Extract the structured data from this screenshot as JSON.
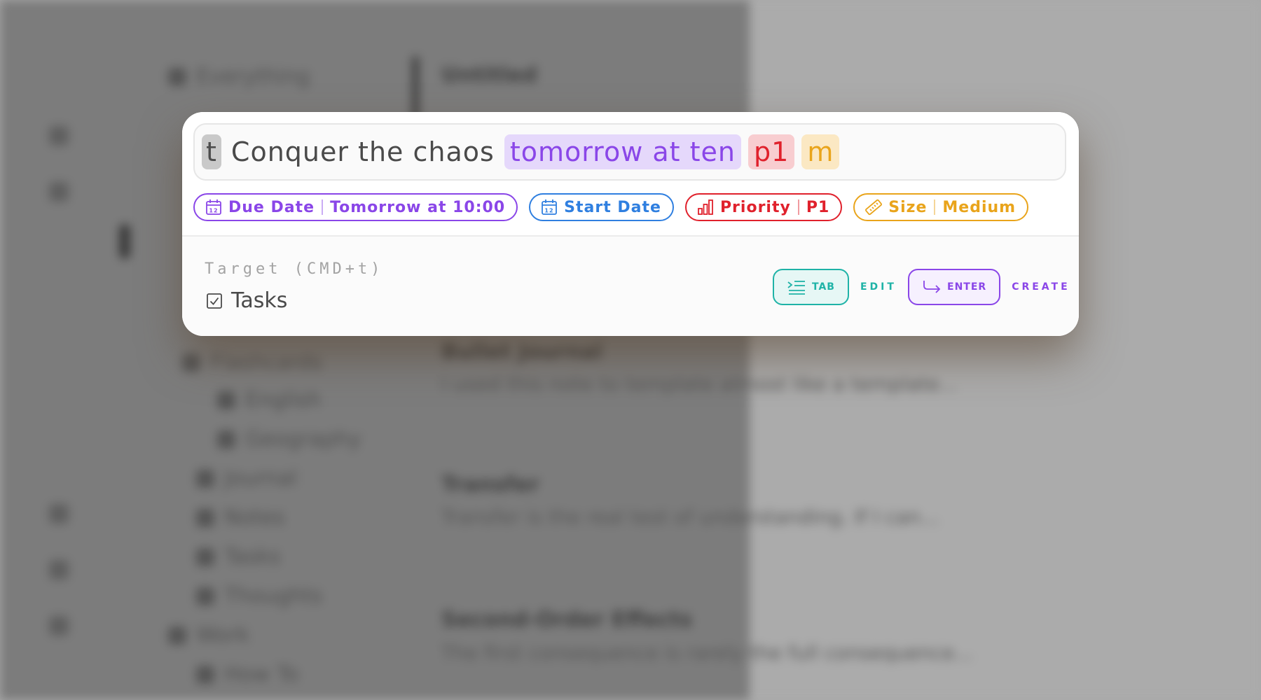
{
  "background": {
    "sidebar_items": [
      "Everything",
      "Flashcards",
      "English",
      "Geography",
      "Journal",
      "Notes",
      "Tasks",
      "Thoughts",
      "Work",
      "How To"
    ],
    "notes": [
      {
        "title": "Untitled",
        "preview": ""
      },
      {
        "title": "Bullet Journal",
        "preview": "I used this note to template almost like a template..."
      },
      {
        "title": "Transfer",
        "preview": "Transfer is the real test of understanding. If I can..."
      },
      {
        "title": "Second-Order Effects",
        "preview": "The first consequence is rarely the full consequence..."
      }
    ]
  },
  "quick_add": {
    "input_tokens": [
      {
        "kind": "prefix",
        "text": "t"
      },
      {
        "kind": "plain",
        "text": "Conquer the chaos"
      },
      {
        "kind": "date",
        "text": "tomorrow at ten"
      },
      {
        "kind": "priority",
        "text": "p1"
      },
      {
        "kind": "size",
        "text": "m"
      }
    ],
    "chips": {
      "due_date": {
        "label": "Due Date",
        "value": "Tomorrow at 10:00",
        "icon": "calendar-icon"
      },
      "start_date": {
        "label": "Start Date",
        "icon": "calendar-icon"
      },
      "priority": {
        "label": "Priority",
        "value": "P1",
        "icon": "bar-chart-icon"
      },
      "size": {
        "label": "Size",
        "value": "Medium",
        "icon": "ruler-icon"
      }
    },
    "target": {
      "label": "Target (CMD+t)",
      "value": "Tasks",
      "icon": "checkbox-icon"
    },
    "actions": {
      "edit": {
        "key": "TAB",
        "label": "EDIT",
        "icon": "indent-icon"
      },
      "create": {
        "key": "ENTER",
        "label": "CREATE",
        "icon": "return-arrow-icon"
      }
    }
  },
  "colors": {
    "purple": "#8a46e8",
    "blue": "#2f7fe0",
    "red": "#e0212c",
    "amber": "#e9a41b",
    "teal": "#1fb3a7"
  }
}
